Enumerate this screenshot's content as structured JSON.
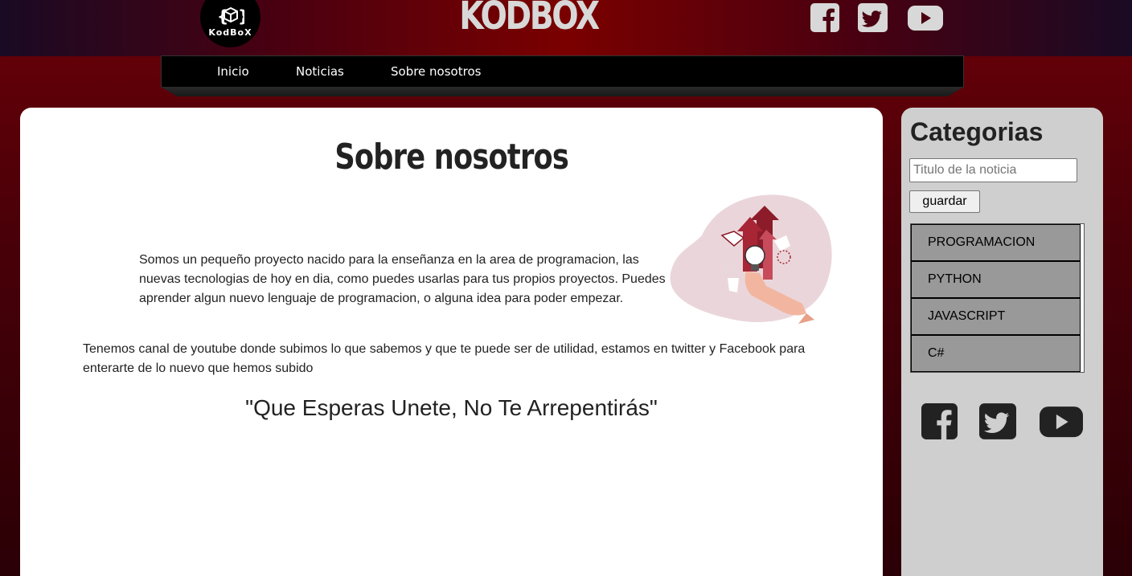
{
  "header": {
    "logo_text": "KodBoX",
    "site_title": "KODBOX",
    "social": [
      {
        "icon": "facebook-icon"
      },
      {
        "icon": "twitter-icon"
      },
      {
        "icon": "youtube-icon"
      }
    ]
  },
  "nav": {
    "items": [
      {
        "label": "Inicio"
      },
      {
        "label": "Noticias"
      },
      {
        "label": "Sobre nosotros"
      }
    ]
  },
  "main": {
    "title": "Sobre nosotros",
    "paragraph1": "Somos un pequeño proyecto nacido para la enseñanza en la area de programacion, las nuevas tecnologias de hoy en dia, como puedes usarlas para tus propios proyectos. Puedes aprender algun nuevo lenguaje de programacion, o alguna idea para poder empezar.",
    "paragraph2": "Tenemos canal de youtube donde subimos lo que sabemos y que te puede ser de utilidad, estamos en twitter y Facebook para enterarte de lo nuevo que hemos subido",
    "quote": "\"Que Esperas Unete, No Te Arrepentirás\""
  },
  "sidebar": {
    "title": "Categorias",
    "search_placeholder": "Titulo de la noticia",
    "save_label": "guardar",
    "categories": [
      {
        "label": "PROGRAMACION"
      },
      {
        "label": "PYTHON"
      },
      {
        "label": "JAVASCRIPT"
      },
      {
        "label": "C#"
      }
    ]
  },
  "colors": {
    "accent_red": "#7a0000",
    "dark_bg": "#2a0006",
    "sidebar_bg": "#d0cfd0",
    "category_bg": "#999999",
    "icon_light": "#d8d8d8",
    "icon_dark": "#222222"
  }
}
